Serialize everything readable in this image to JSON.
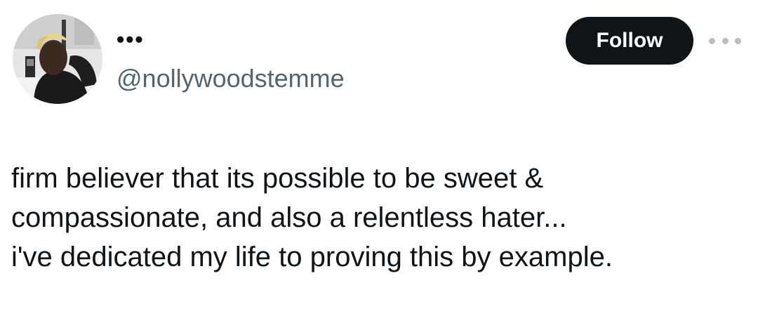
{
  "author": {
    "display_name": "•••",
    "handle": "@nollywoodstemme",
    "avatar_icon": "user-avatar-photo"
  },
  "actions": {
    "follow_label": "Follow",
    "more_icon": "more-options-icon"
  },
  "tweet": {
    "lines": [
      "firm believer that its possible to be sweet &",
      "compassionate, and also a relentless hater...",
      "i've dedicated my life to proving this by example."
    ]
  },
  "colors": {
    "text_primary": "#0f1419",
    "text_secondary": "#536471",
    "button_bg": "#0f1419",
    "button_text": "#ffffff"
  }
}
